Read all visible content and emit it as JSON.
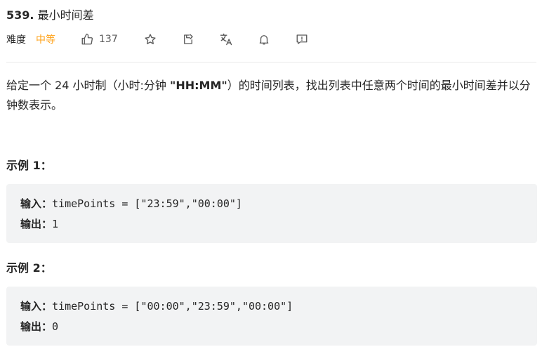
{
  "problem": {
    "number": "539.",
    "title": "最小时间差"
  },
  "meta": {
    "difficulty_label": "难度",
    "difficulty_value": "中等",
    "difficulty_color": "#ffa116",
    "likes": "137",
    "icons": [
      "thumbs-up-icon",
      "star-icon",
      "share-icon",
      "translate-icon",
      "bell-icon",
      "feedback-icon"
    ]
  },
  "description": {
    "part1": "给定一个 24 小时制（小时:分钟 ",
    "bold": "\"HH:MM\"",
    "part2": "）的时间列表，找出列表中任意两个时间的最小时间差并以分钟数表示。"
  },
  "examples": [
    {
      "title": "示例 1：",
      "input_label": "输入：",
      "input_value": "timePoints = [\"23:59\",\"00:00\"]",
      "output_label": "输出：",
      "output_value": "1"
    },
    {
      "title": "示例 2：",
      "input_label": "输入：",
      "input_value": "timePoints = [\"00:00\",\"23:59\",\"00:00\"]",
      "output_label": "输出：",
      "output_value": "0"
    }
  ]
}
